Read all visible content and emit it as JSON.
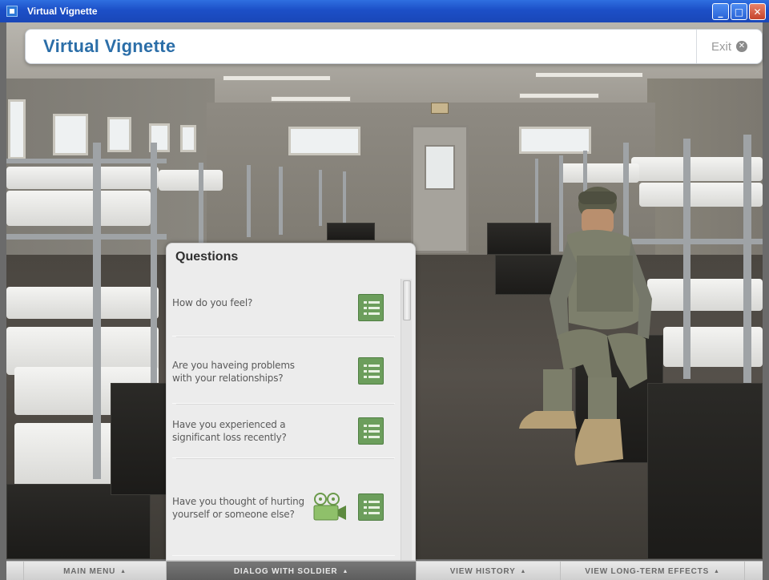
{
  "window": {
    "title": "Virtual Vignette",
    "controls": [
      "minimize",
      "maximize",
      "close"
    ]
  },
  "header": {
    "app_title": "Virtual Vignette",
    "exit_label": "Exit"
  },
  "questions_panel": {
    "title": "Questions",
    "items": [
      {
        "text": "How do you feel?",
        "has_video": false
      },
      {
        "text": "Are you haveing problems with your relationships?",
        "has_video": false
      },
      {
        "text": "Have you experienced a significant loss recently?",
        "has_video": false
      },
      {
        "text": "Have you thought of hurting yourself or someone else?",
        "has_video": true
      }
    ],
    "item_icon": "list-icon",
    "video_icon": "video-camera-icon"
  },
  "bottom_nav": {
    "items": [
      {
        "label": "MAIN MENU",
        "active": false
      },
      {
        "label": "DIALOG WITH SOLDIER",
        "active": true
      },
      {
        "label": "VIEW HISTORY",
        "active": false
      },
      {
        "label": "VIEW LONG-TERM EFFECTS",
        "active": false
      }
    ],
    "arrow": "▲"
  },
  "colors": {
    "title_blue": "#2b6ea8",
    "button_green": "#6c9e5c",
    "xp_titlebar": "#1c4fc7"
  }
}
